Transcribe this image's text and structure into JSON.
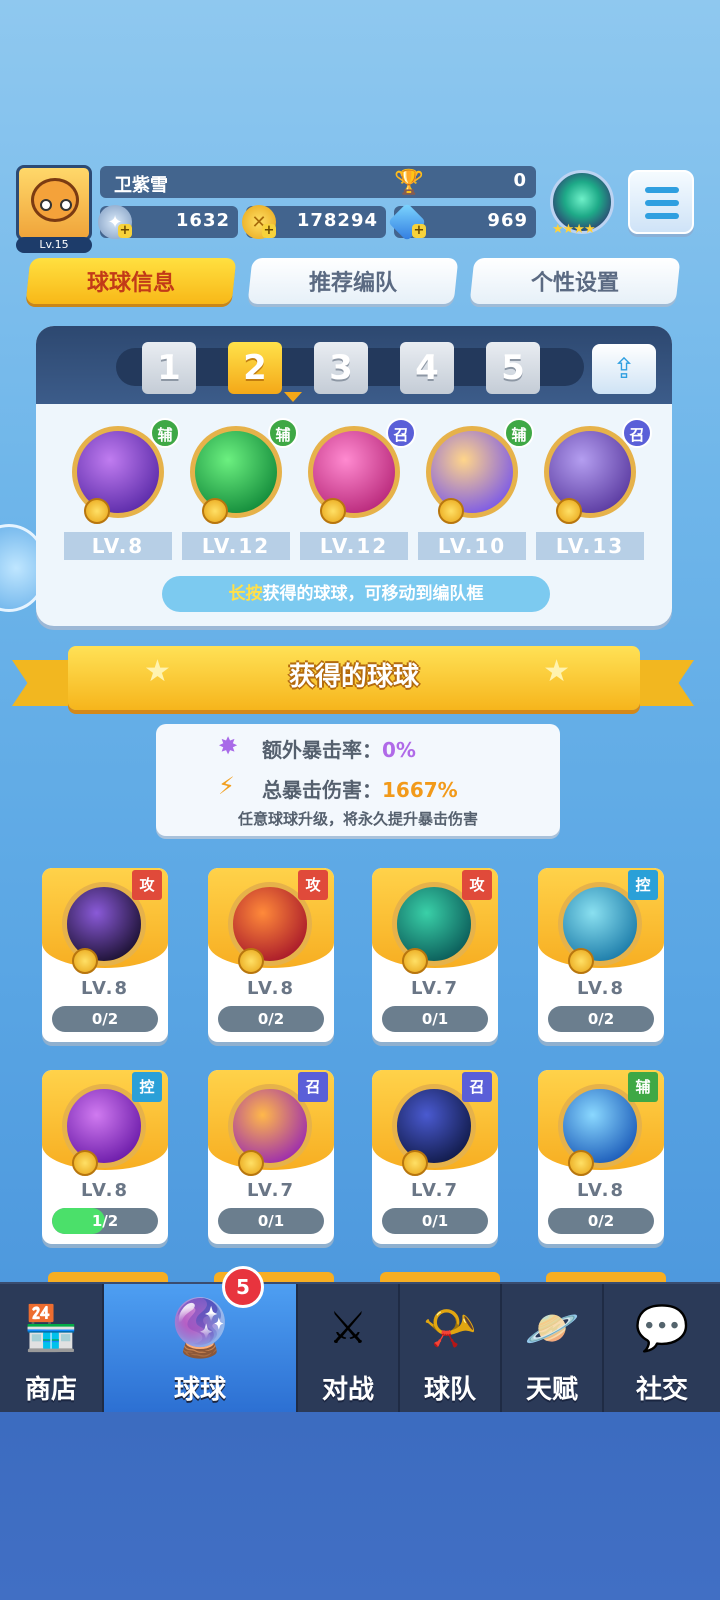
{
  "player": {
    "name": "卫紫雪",
    "level_label": "Lv.15",
    "trophy_count": "0",
    "stamina": "1632",
    "coins": "178294",
    "gems": "969"
  },
  "tabs": [
    {
      "label": "球球信息",
      "active": true
    },
    {
      "label": "推荐编队",
      "active": false
    },
    {
      "label": "个性设置",
      "active": false
    }
  ],
  "team": {
    "slots": [
      "1",
      "2",
      "3",
      "4",
      "5"
    ],
    "active_slot": "2",
    "balls": [
      {
        "tag": "辅",
        "tag_color": "#3fa845",
        "level": "LV.8",
        "color1": "#c07cf0",
        "color2": "#5a2aa8"
      },
      {
        "tag": "辅",
        "tag_color": "#3fa845",
        "level": "LV.12",
        "color1": "#6cf080",
        "color2": "#128a3a"
      },
      {
        "tag": "召",
        "tag_color": "#5a5fd8",
        "level": "LV.12",
        "color1": "#ff8ad0",
        "color2": "#b8287a"
      },
      {
        "tag": "辅",
        "tag_color": "#3fa845",
        "level": "LV.10",
        "color1": "#ffd58a",
        "color2": "#7a58e8"
      },
      {
        "tag": "召",
        "tag_color": "#5a5fd8",
        "level": "LV.13",
        "color1": "#b49ef0",
        "color2": "#5a3aa0"
      }
    ],
    "hint_highlight": "长按",
    "hint_text": "获得的球球，可移动到编队框"
  },
  "section_title": "获得的球球",
  "crit": {
    "extra_rate_label": "额外暴击率：",
    "extra_rate_value": "0%",
    "total_damage_label": "总暴击伤害：",
    "total_damage_value": "1667%",
    "note": "任意球球升级，将永久提升暴击伤害"
  },
  "owned_balls": [
    {
      "tag": "攻",
      "tag_color": "#e04a3a",
      "level": "LV.8",
      "progress": "0/2",
      "fill": 0,
      "color1": "#8a5ad8",
      "color2": "#1a1030"
    },
    {
      "tag": "攻",
      "tag_color": "#e04a3a",
      "level": "LV.8",
      "progress": "0/2",
      "fill": 0,
      "color1": "#ff8a3a",
      "color2": "#a8182a"
    },
    {
      "tag": "攻",
      "tag_color": "#e04a3a",
      "level": "LV.7",
      "progress": "0/1",
      "fill": 0,
      "color1": "#3ad0a8",
      "color2": "#0a5a58"
    },
    {
      "tag": "控",
      "tag_color": "#2aa0d8",
      "level": "LV.8",
      "progress": "0/2",
      "fill": 0,
      "color1": "#8ae0f0",
      "color2": "#1a7aa8"
    },
    {
      "tag": "控",
      "tag_color": "#2aa0d8",
      "level": "LV.8",
      "progress": "1/2",
      "fill": 0.5,
      "color1": "#d07af0",
      "color2": "#6a1aa8"
    },
    {
      "tag": "召",
      "tag_color": "#5a5fd8",
      "level": "LV.7",
      "progress": "0/1",
      "fill": 0,
      "color1": "#ffb84a",
      "color2": "#9a2ab0"
    },
    {
      "tag": "召",
      "tag_color": "#5a5fd8",
      "level": "LV.7",
      "progress": "0/1",
      "fill": 0,
      "color1": "#4a5ad0",
      "color2": "#101a48"
    },
    {
      "tag": "辅",
      "tag_color": "#3fa845",
      "level": "LV.8",
      "progress": "0/2",
      "fill": 0,
      "color1": "#8ad8ff",
      "color2": "#1a5ab8"
    }
  ],
  "nav": {
    "items": [
      "商店",
      "球球",
      "对战",
      "球队",
      "天赋",
      "社交"
    ],
    "active": "球球",
    "balls_badge": "5"
  }
}
